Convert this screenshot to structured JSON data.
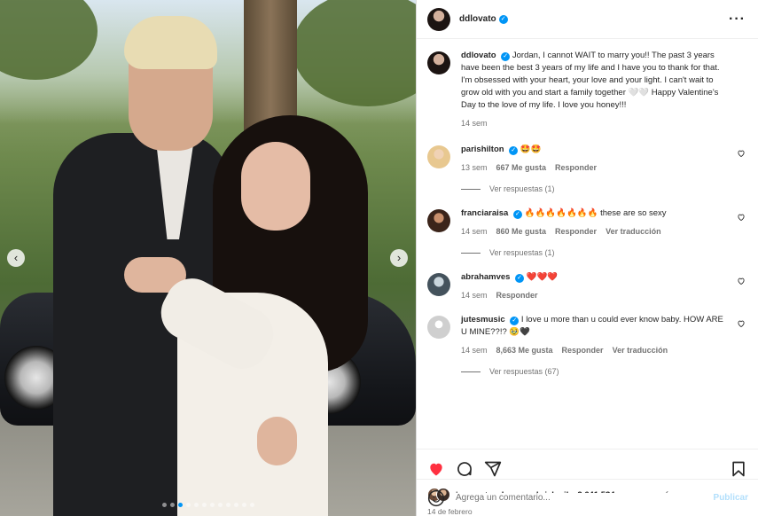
{
  "post": {
    "author": "ddlovato",
    "verified_icon": "verified-badge-icon",
    "more_icon": "more-options-icon",
    "caption": {
      "author": "ddlovato",
      "text": "Jordan, I cannot WAIT to marry you!! The past 3 years have been the best 3 years of my life and I have you to thank for that. I'm obsessed with your heart, your love and your light. I can't wait to grow old with you and start a family together 🤍🤍 Happy Valentine's Day to the love of my life. I love you honey!!!",
      "time": "14 sem"
    },
    "carousel": {
      "total_dots": 12,
      "active_index": 2,
      "prev_icon": "chevron-left-icon",
      "next_icon": "chevron-right-icon"
    }
  },
  "comments": [
    {
      "user": "parishilton",
      "text": "🤩🤩",
      "time": "13 sem",
      "likes": "667 Me gusta",
      "reply": "Responder",
      "translate": "",
      "view_replies": "Ver respuestas (1)"
    },
    {
      "user": "franciaraisa",
      "text": "🔥🔥🔥🔥🔥🔥🔥 these are so sexy",
      "time": "14 sem",
      "likes": "860 Me gusta",
      "reply": "Responder",
      "translate": "Ver traducción",
      "view_replies": "Ver respuestas (1)"
    },
    {
      "user": "abrahamves",
      "text": "❤️❤️❤️",
      "time": "14 sem",
      "likes": "",
      "reply": "Responder",
      "translate": "",
      "view_replies": ""
    },
    {
      "user": "jutesmusic",
      "text": "I love u more than u could ever know baby. HOW ARE U MINE??!? 🥹🖤",
      "time": "14 sem",
      "likes": "8,663 Me gusta",
      "reply": "Responder",
      "translate": "Ver traducción",
      "view_replies": "Ver respuestas (67)"
    }
  ],
  "likes_summary": {
    "prefix": "Les gusta a ",
    "user": "karemgabrielagil",
    "middle": " y ",
    "count": "2.641.534 personas más"
  },
  "date": "14 de febrero",
  "composer": {
    "placeholder": "Agrega un comentario...",
    "publish_label": "Publicar",
    "emoji_icon": "emoji-icon"
  },
  "colors": {
    "accent": "#0095f6",
    "like_red": "#ff3040",
    "muted": "#737373",
    "publish_disabled": "#b2dffc"
  }
}
